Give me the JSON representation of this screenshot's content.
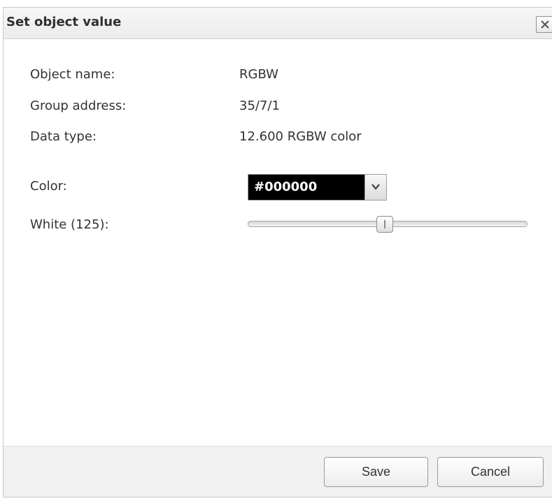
{
  "dialog": {
    "title": "Set object value",
    "close_icon": "close-icon"
  },
  "fields": {
    "object_name": {
      "label": "Object name:",
      "value": "RGBW"
    },
    "group_address": {
      "label": "Group address:",
      "value": "35/7/1"
    },
    "data_type": {
      "label": "Data type:",
      "value": "12.600 RGBW color"
    },
    "color": {
      "label": "Color:",
      "value": "#000000",
      "swatch_color": "#000000",
      "dropdown_icon": "chevron-down-icon"
    },
    "white": {
      "label": "White (125):",
      "level": 125,
      "max": 255
    }
  },
  "footer": {
    "save_label": "Save",
    "cancel_label": "Cancel"
  }
}
